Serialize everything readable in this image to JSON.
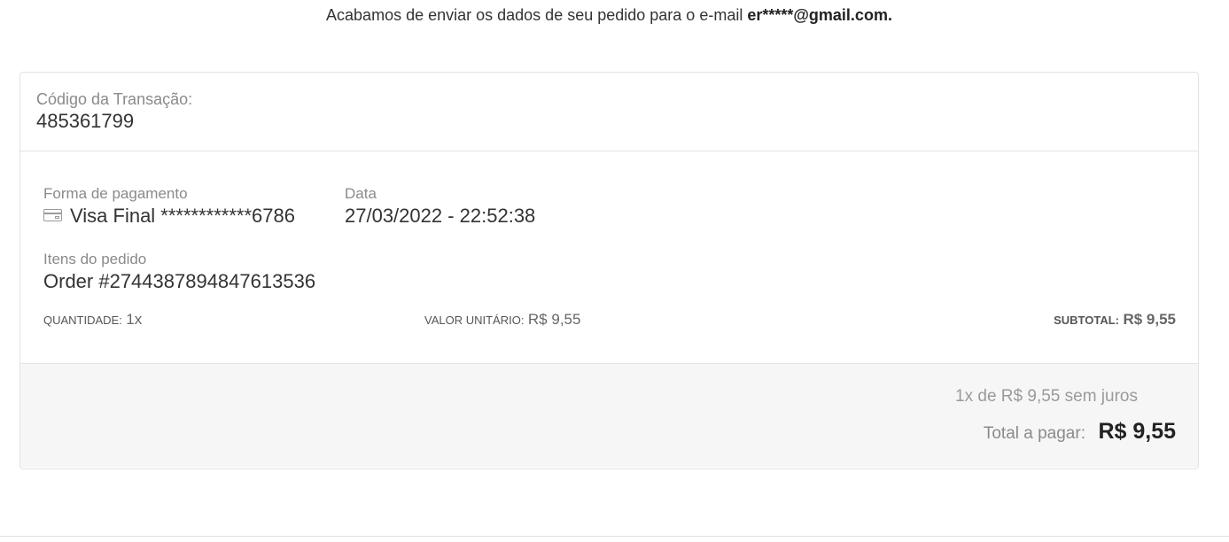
{
  "notice": {
    "text": "Acabamos de enviar os dados de seu pedido para o e-mail ",
    "email": "er*****@gmail.com."
  },
  "transaction": {
    "label": "Código da Transação:",
    "code": "485361799"
  },
  "payment": {
    "label": "Forma de pagamento",
    "method": "Visa Final ************6786",
    "icon": "credit-card-icon"
  },
  "date": {
    "label": "Data",
    "value": "27/03/2022 - 22:52:38"
  },
  "items": {
    "label": "Itens do pedido",
    "order": "Order #2744387894847613536",
    "quantity_label": "QUANTIDADE:",
    "quantity_value": "1x",
    "unit_label": "VALOR UNITÁRIO:",
    "unit_value": "R$ 9,55",
    "subtotal_label": "SUBTOTAL:",
    "subtotal_value": "R$ 9,55"
  },
  "totals": {
    "installments": "1x de R$ 9,55 sem juros",
    "total_label": "Total a pagar:",
    "total_value": "R$ 9,55"
  }
}
